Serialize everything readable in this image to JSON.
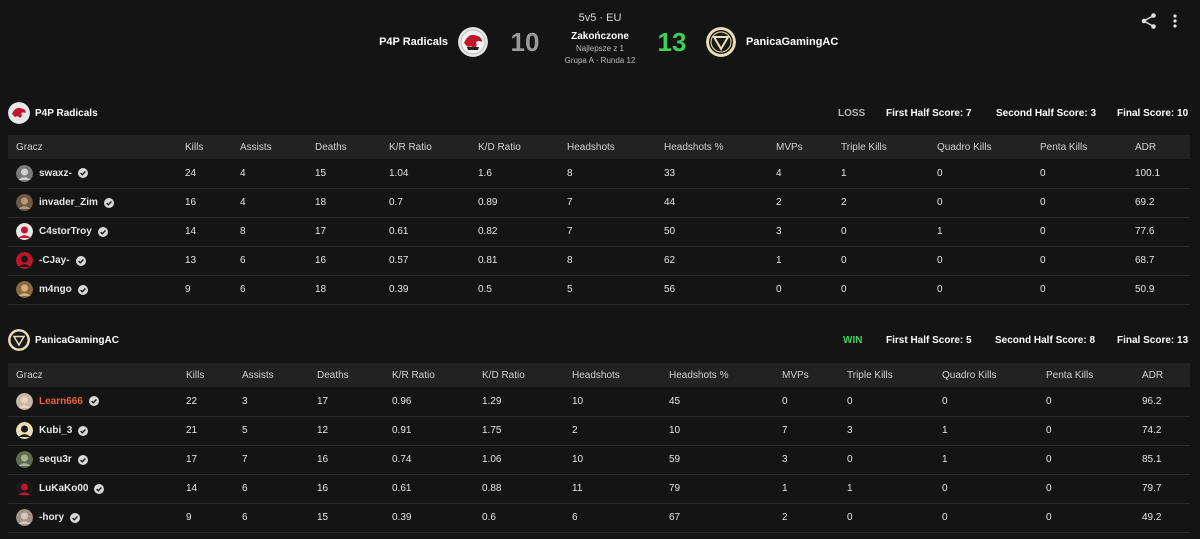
{
  "match": {
    "mode": "5v5 · EU",
    "status": "Zakończone",
    "best_of": "Najlepsze z 1",
    "round": "Grupa A · Runda 12",
    "team_left": {
      "name": "P4P Radicals",
      "score": "10"
    },
    "team_right": {
      "name": "PanicaGamingAC",
      "score": "13"
    }
  },
  "columns": [
    "Gracz",
    "Kills",
    "Assists",
    "Deaths",
    "K/R Ratio",
    "K/D Ratio",
    "Headshots",
    "Headshots %",
    "MVPs",
    "Triple Kills",
    "Quadro Kills",
    "Penta Kills",
    "ADR"
  ],
  "teams": [
    {
      "name": "P4P Radicals",
      "result": "LOSS",
      "first_half": "First Half Score: 7",
      "second_half": "Second Half Score: 3",
      "final": "Final Score: 10",
      "players": [
        {
          "name": "swaxz-",
          "stats": [
            "24",
            "4",
            "15",
            "1.04",
            "1.6",
            "8",
            "33",
            "4",
            "1",
            "0",
            "0",
            "100.1"
          ]
        },
        {
          "name": "invader_Zim",
          "stats": [
            "16",
            "4",
            "18",
            "0.7",
            "0.89",
            "7",
            "44",
            "2",
            "2",
            "0",
            "0",
            "69.2"
          ]
        },
        {
          "name": "C4storTroy",
          "stats": [
            "14",
            "8",
            "17",
            "0.61",
            "0.82",
            "7",
            "50",
            "3",
            "0",
            "1",
            "0",
            "77.6"
          ]
        },
        {
          "name": "-CJay-",
          "stats": [
            "13",
            "6",
            "16",
            "0.57",
            "0.81",
            "8",
            "62",
            "1",
            "0",
            "0",
            "0",
            "68.7"
          ]
        },
        {
          "name": "m4ngo",
          "stats": [
            "9",
            "6",
            "18",
            "0.39",
            "0.5",
            "5",
            "56",
            "0",
            "0",
            "0",
            "0",
            "50.9"
          ]
        }
      ]
    },
    {
      "name": "PanicaGamingAC",
      "result": "WIN",
      "first_half": "First Half Score: 5",
      "second_half": "Second Half Score: 8",
      "final": "Final Score: 13",
      "players": [
        {
          "name": "Learn666",
          "stats": [
            "22",
            "3",
            "17",
            "0.96",
            "1.29",
            "10",
            "45",
            "0",
            "0",
            "0",
            "0",
            "96.2"
          ]
        },
        {
          "name": "Kubi_3",
          "stats": [
            "21",
            "5",
            "12",
            "0.91",
            "1.75",
            "2",
            "10",
            "7",
            "3",
            "1",
            "0",
            "74.2"
          ]
        },
        {
          "name": "sequ3r",
          "stats": [
            "17",
            "7",
            "16",
            "0.74",
            "1.06",
            "10",
            "59",
            "3",
            "0",
            "1",
            "0",
            "85.1"
          ]
        },
        {
          "name": "LuKaKo00",
          "stats": [
            "14",
            "6",
            "16",
            "0.61",
            "0.88",
            "11",
            "79",
            "1",
            "1",
            "0",
            "0",
            "79.7"
          ]
        },
        {
          "name": "-hory",
          "stats": [
            "9",
            "6",
            "15",
            "0.39",
            "0.6",
            "6",
            "67",
            "2",
            "0",
            "0",
            "0",
            "49.2"
          ]
        }
      ]
    }
  ],
  "colors": {
    "win": "#3fcf5a",
    "loss": "#b5b5b5",
    "highlight_player": "#e8623a",
    "verified": "#d8d8d8"
  },
  "icons": {
    "share": "share-icon",
    "more": "more-vertical-icon",
    "verified": "verified-badge-icon"
  }
}
